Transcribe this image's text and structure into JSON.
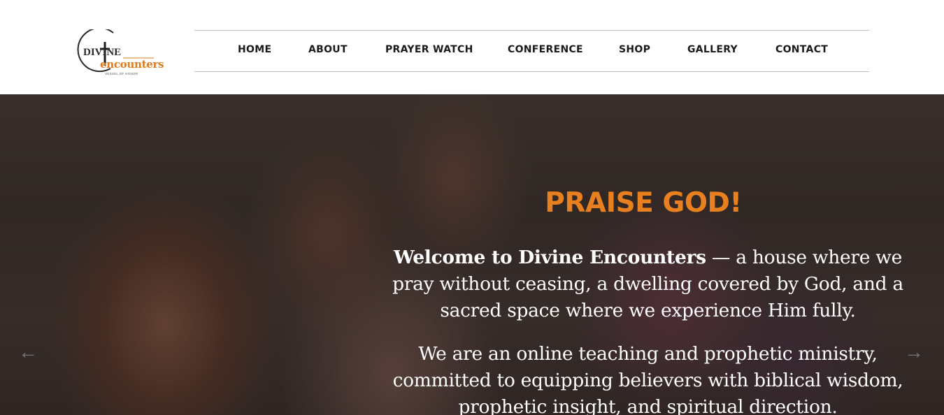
{
  "logo": {
    "word1": "DIVINE",
    "word2": "encounters",
    "tagline": "VESSEL OF HONOR"
  },
  "nav": {
    "items": [
      {
        "label": "HOME"
      },
      {
        "label": "ABOUT"
      },
      {
        "label": "PRAYER WATCH"
      },
      {
        "label": "CONFERENCE"
      },
      {
        "label": "SHOP"
      },
      {
        "label": "GALLERY"
      },
      {
        "label": "CONTACT"
      }
    ]
  },
  "hero": {
    "title": "PRAISE GOD!",
    "intro_bold": "Welcome to Divine Encounters",
    "intro_rest": " — a house where we pray without ceasing, a dwelling covered by God, and a sacred space where we experience Him fully.",
    "paragraph2": "We are an online teaching and prophetic ministry, committed to equipping believers with biblical wisdom, prophetic insight, and spiritual direction.",
    "prev_arrow": "←",
    "next_arrow": "→"
  },
  "colors": {
    "accent_orange": "#e8801f",
    "nav_text": "#1a1a1a",
    "hero_text": "#ffffff"
  },
  "icons": {
    "logo_mark": "cross-circle-icon",
    "prev": "arrow-left-icon",
    "next": "arrow-right-icon"
  }
}
